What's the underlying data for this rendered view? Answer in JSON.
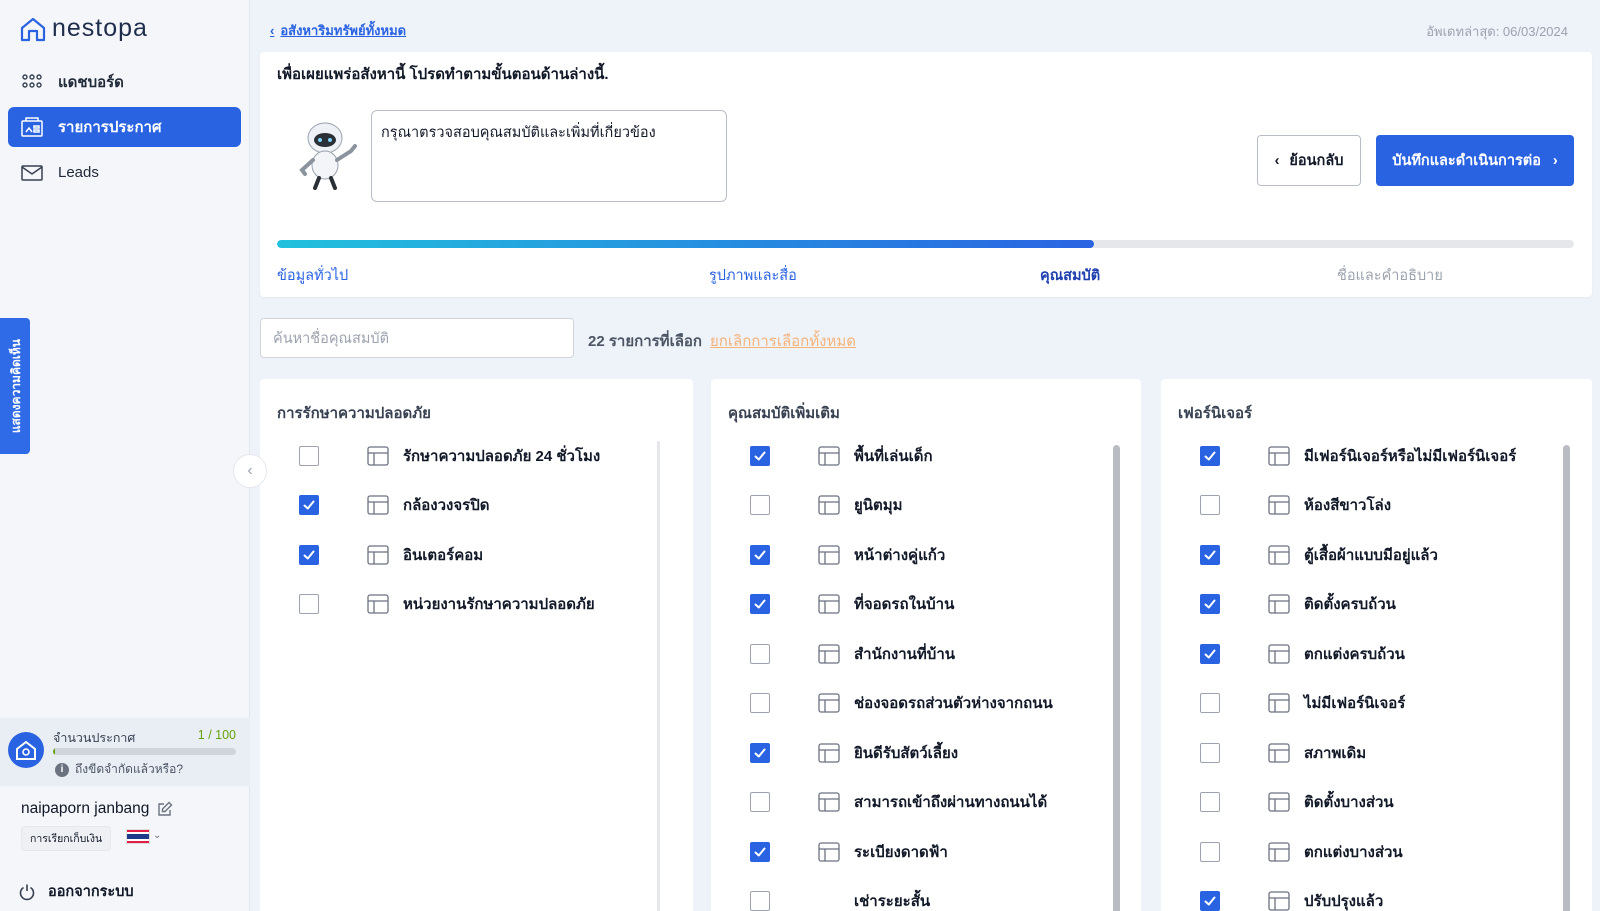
{
  "app": {
    "brand": "nestopa"
  },
  "sidebar": {
    "nav": [
      {
        "label": "แดชบอร์ด",
        "icon": "dashboard-grid-icon"
      },
      {
        "label": "รายการประกาศ",
        "icon": "listing-icon"
      },
      {
        "label": "Leads",
        "icon": "mail-icon"
      }
    ],
    "feedback": "แสดงความคิดเห็น",
    "quota": {
      "title": "จำนวนประกาศ",
      "count": "1 / 100",
      "used_fraction": 0.01,
      "hint": "ถึงขีดจำกัดแล้วหรือ?"
    },
    "user": {
      "name": "naipaporn janbang",
      "billing": "การเรียกเก็บเงิน"
    },
    "logout": "ออกจากระบบ"
  },
  "header": {
    "back_label": "อสังหาริมทรัพย์ทั้งหมด",
    "updated": "อัพเดทล่าสุด: 06/03/2024"
  },
  "wizard": {
    "instruction": "เพื่อเผยแพร่อสังหานี้ โปรดทำตามขั้นตอนด้านล่างนี้.",
    "bubble": "กรุณาตรวจสอบคุณสมบัติและเพิ่มที่เกี่ยวข้อง",
    "back_button": "ย้อนกลับ",
    "next_button": "บันทึกและดำเนินการต่อ",
    "progress": 0.63,
    "steps": [
      "ข้อมูลทั่วไป",
      "รูปภาพและสื่อ",
      "คุณสมบัติ",
      "ชื่อและคำอธิบาย"
    ],
    "current_step": 2
  },
  "filter": {
    "placeholder": "ค้นหาชื่อคุณสมบัติ",
    "selected": "22 รายการที่เลือก",
    "clear": "ยกเลิกการเลือกทั้งหมด"
  },
  "groups": [
    {
      "title": "การรักษาความปลอดภัย",
      "items": [
        {
          "label": "รักษาความปลอดภัย 24 ชั่วโมง",
          "checked": false,
          "icon": "clock-24-icon"
        },
        {
          "label": "กล้องวงจรปิด",
          "checked": true,
          "icon": "cctv-icon"
        },
        {
          "label": "อินเตอร์คอม",
          "checked": true,
          "icon": "intercom-icon"
        },
        {
          "label": "หน่วยงานรักษาความปลอดภัย",
          "checked": false,
          "icon": "security-guard-icon"
        }
      ]
    },
    {
      "title": "คุณสมบัติเพิ่มเติม",
      "items": [
        {
          "label": "พื้นที่เล่นเด็ก",
          "checked": true,
          "icon": "playground-icon"
        },
        {
          "label": "ยูนิตมุม",
          "checked": false,
          "icon": "corner-unit-icon"
        },
        {
          "label": "หน้าต่างคู่แก้ว",
          "checked": true,
          "icon": "window-icon"
        },
        {
          "label": "ที่จอดรถในบ้าน",
          "checked": true,
          "icon": "garage-icon"
        },
        {
          "label": "สำนักงานที่บ้าน",
          "checked": false,
          "icon": "home-office-icon"
        },
        {
          "label": "ช่องจอดรถส่วนตัวห่างจากถนน",
          "checked": false,
          "icon": "parking-pin-icon"
        },
        {
          "label": "ยินดีรับสัตว์เลี้ยง",
          "checked": true,
          "icon": "paw-icon"
        },
        {
          "label": "สามารถเข้าถึงผ่านทางถนนได้",
          "checked": false,
          "icon": "road-icon"
        },
        {
          "label": "ระเบียงดาดฟ้า",
          "checked": true,
          "icon": "rooftop-terrace-icon"
        },
        {
          "label": "เช่าระยะสั้น",
          "checked": false,
          "icon": ""
        }
      ]
    },
    {
      "title": "เฟอร์นิเจอร์",
      "items": [
        {
          "label": "มีเฟอร์นิเจอร์หรือไม่มีเฟอร์นิเจอร์",
          "checked": true,
          "icon": "armchair-icon"
        },
        {
          "label": "ห้องสีขาวโล่ง",
          "checked": false,
          "icon": "empty-room-icon"
        },
        {
          "label": "ตู้เสื้อผ้าแบบมีอยู่แล้ว",
          "checked": true,
          "icon": "wardrobe-icon"
        },
        {
          "label": "ติดตั้งครบถ้วน",
          "checked": true,
          "icon": "fully-fitted-icon"
        },
        {
          "label": "ตกแต่งครบถ้วน",
          "checked": true,
          "icon": "fully-furnished-icon"
        },
        {
          "label": "ไม่มีเฟอร์นิเจอร์",
          "checked": false,
          "icon": "no-furniture-icon"
        },
        {
          "label": "สภาพเดิม",
          "checked": false,
          "icon": "original-condition-icon"
        },
        {
          "label": "ติดตั้งบางส่วน",
          "checked": false,
          "icon": "partly-fitted-icon"
        },
        {
          "label": "ตกแต่งบางส่วน",
          "checked": false,
          "icon": "partly-furnished-icon"
        },
        {
          "label": "ปรับปรุงแล้ว",
          "checked": true,
          "icon": "renovated-icon"
        }
      ]
    }
  ],
  "colors": {
    "primary": "#2a63e2",
    "progress_start": "#22c1dd",
    "quota": "#65a30d",
    "clear_link": "#f5b37a"
  }
}
